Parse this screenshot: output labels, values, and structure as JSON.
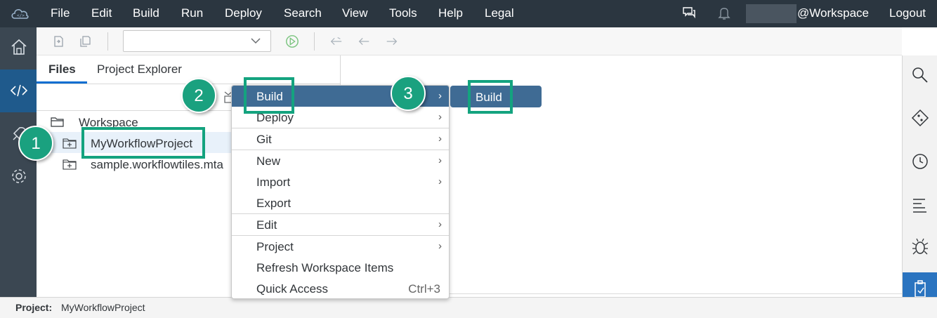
{
  "menubar": {
    "items": [
      "File",
      "Edit",
      "Build",
      "Run",
      "Deploy",
      "Search",
      "View",
      "Tools",
      "Help",
      "Legal"
    ],
    "user": "@Workspace",
    "logout": "Logout"
  },
  "panel": {
    "tabs": [
      "Files",
      "Project Explorer"
    ],
    "tree": {
      "root": "Workspace",
      "items": [
        "MyWorkflowProject",
        "sample.workflowtiles.mta"
      ]
    }
  },
  "context_menu": {
    "items": [
      {
        "label": "Build",
        "submenu": true
      },
      {
        "label": "Deploy",
        "submenu": true
      },
      {
        "label": "Git",
        "submenu": true
      },
      {
        "label": "New",
        "submenu": true
      },
      {
        "label": "Import",
        "submenu": true
      },
      {
        "label": "Export",
        "submenu": false
      },
      {
        "label": "Edit",
        "submenu": true
      },
      {
        "label": "Project",
        "submenu": true
      },
      {
        "label": "Refresh Workspace Items",
        "submenu": false
      },
      {
        "label": "Quick Access",
        "submenu": false,
        "shortcut": "Ctrl+3"
      }
    ],
    "submenu_label": "Build"
  },
  "statusbar": {
    "label": "Project:",
    "value": "MyWorkflowProject"
  },
  "annotations": [
    "1",
    "2",
    "3"
  ],
  "colors": {
    "menubar": "#2b3640",
    "accent": "#3f6b94",
    "highlight": "#14a37f"
  }
}
